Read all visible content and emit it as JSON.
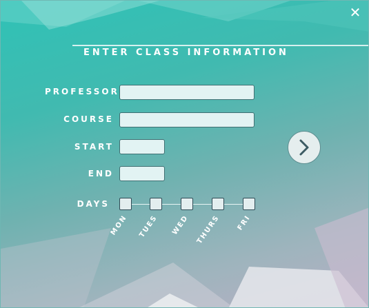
{
  "window": {
    "close_glyph": "✕"
  },
  "form": {
    "title": "ENTER CLASS INFORMATION",
    "fields": {
      "professor": {
        "label": "PROFESSOR",
        "value": ""
      },
      "course": {
        "label": "COURSE",
        "value": ""
      },
      "start": {
        "label": "START",
        "value": ""
      },
      "end": {
        "label": "END",
        "value": ""
      }
    },
    "days": {
      "label": "DAYS",
      "items": [
        "MON",
        "TUES",
        "WED",
        "THURS",
        "FRI"
      ]
    },
    "next_icon": "chevron-right-icon"
  },
  "colors": {
    "accent_top": "#2fc2b6",
    "accent_bottom": "#b8b0c4",
    "input_bg": "#e2f3f3",
    "input_border": "#3f6f72"
  }
}
